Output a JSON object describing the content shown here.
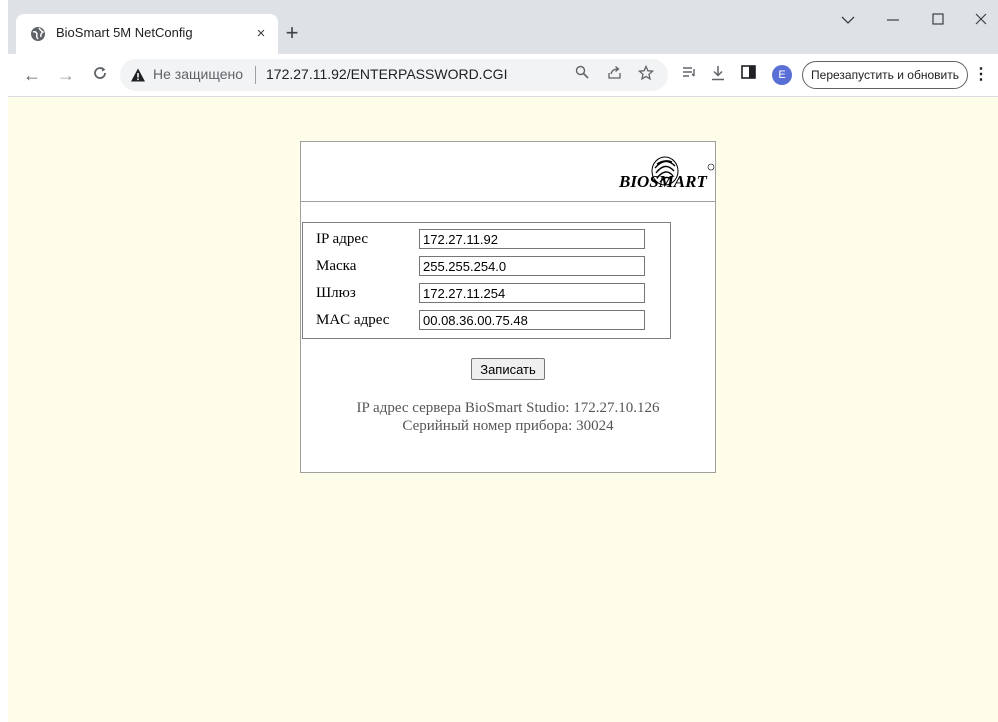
{
  "browser": {
    "tab": {
      "title": "BioSmart 5M NetConfig",
      "close_glyph": "×"
    },
    "new_tab_glyph": "+",
    "window_controls": {
      "dropdown": "⌄",
      "minimize": "—",
      "maximize": "☐",
      "close": "✕"
    },
    "nav": {
      "back": "←",
      "forward": "→",
      "reload": "C"
    },
    "omnibox": {
      "security_label": "Не защищено",
      "url": "172.27.11.92/ENTERPASSWORD.CGI",
      "icons": [
        "search-icon",
        "share-icon",
        "star-icon"
      ]
    },
    "toolbar_icons": [
      "reading-list-icon",
      "download-icon",
      "side-panel-icon"
    ],
    "avatar_letter": "E",
    "relaunch_label": "Перезапустить и обновить",
    "menu_glyph": "⋮"
  },
  "page": {
    "logo_text": "BIOSMART",
    "form": [
      {
        "label": "IP адрес",
        "value": "172.27.11.92"
      },
      {
        "label": "Маска",
        "value": "255.255.254.0"
      },
      {
        "label": "Шлюз",
        "value": "172.27.11.254"
      },
      {
        "label": "MAC адрес",
        "value": "00.08.36.00.75.48"
      }
    ],
    "save_label": "Записать",
    "server_ip_text": "IP адрес сервера BioSmart Studio: 172.27.10.126",
    "serial_text": "Серийный номер прибора: 30024"
  },
  "colors": {
    "page_background": "#fdfde9",
    "tabstrip": "#dee1e6",
    "avatar": "#5a6fd6"
  }
}
